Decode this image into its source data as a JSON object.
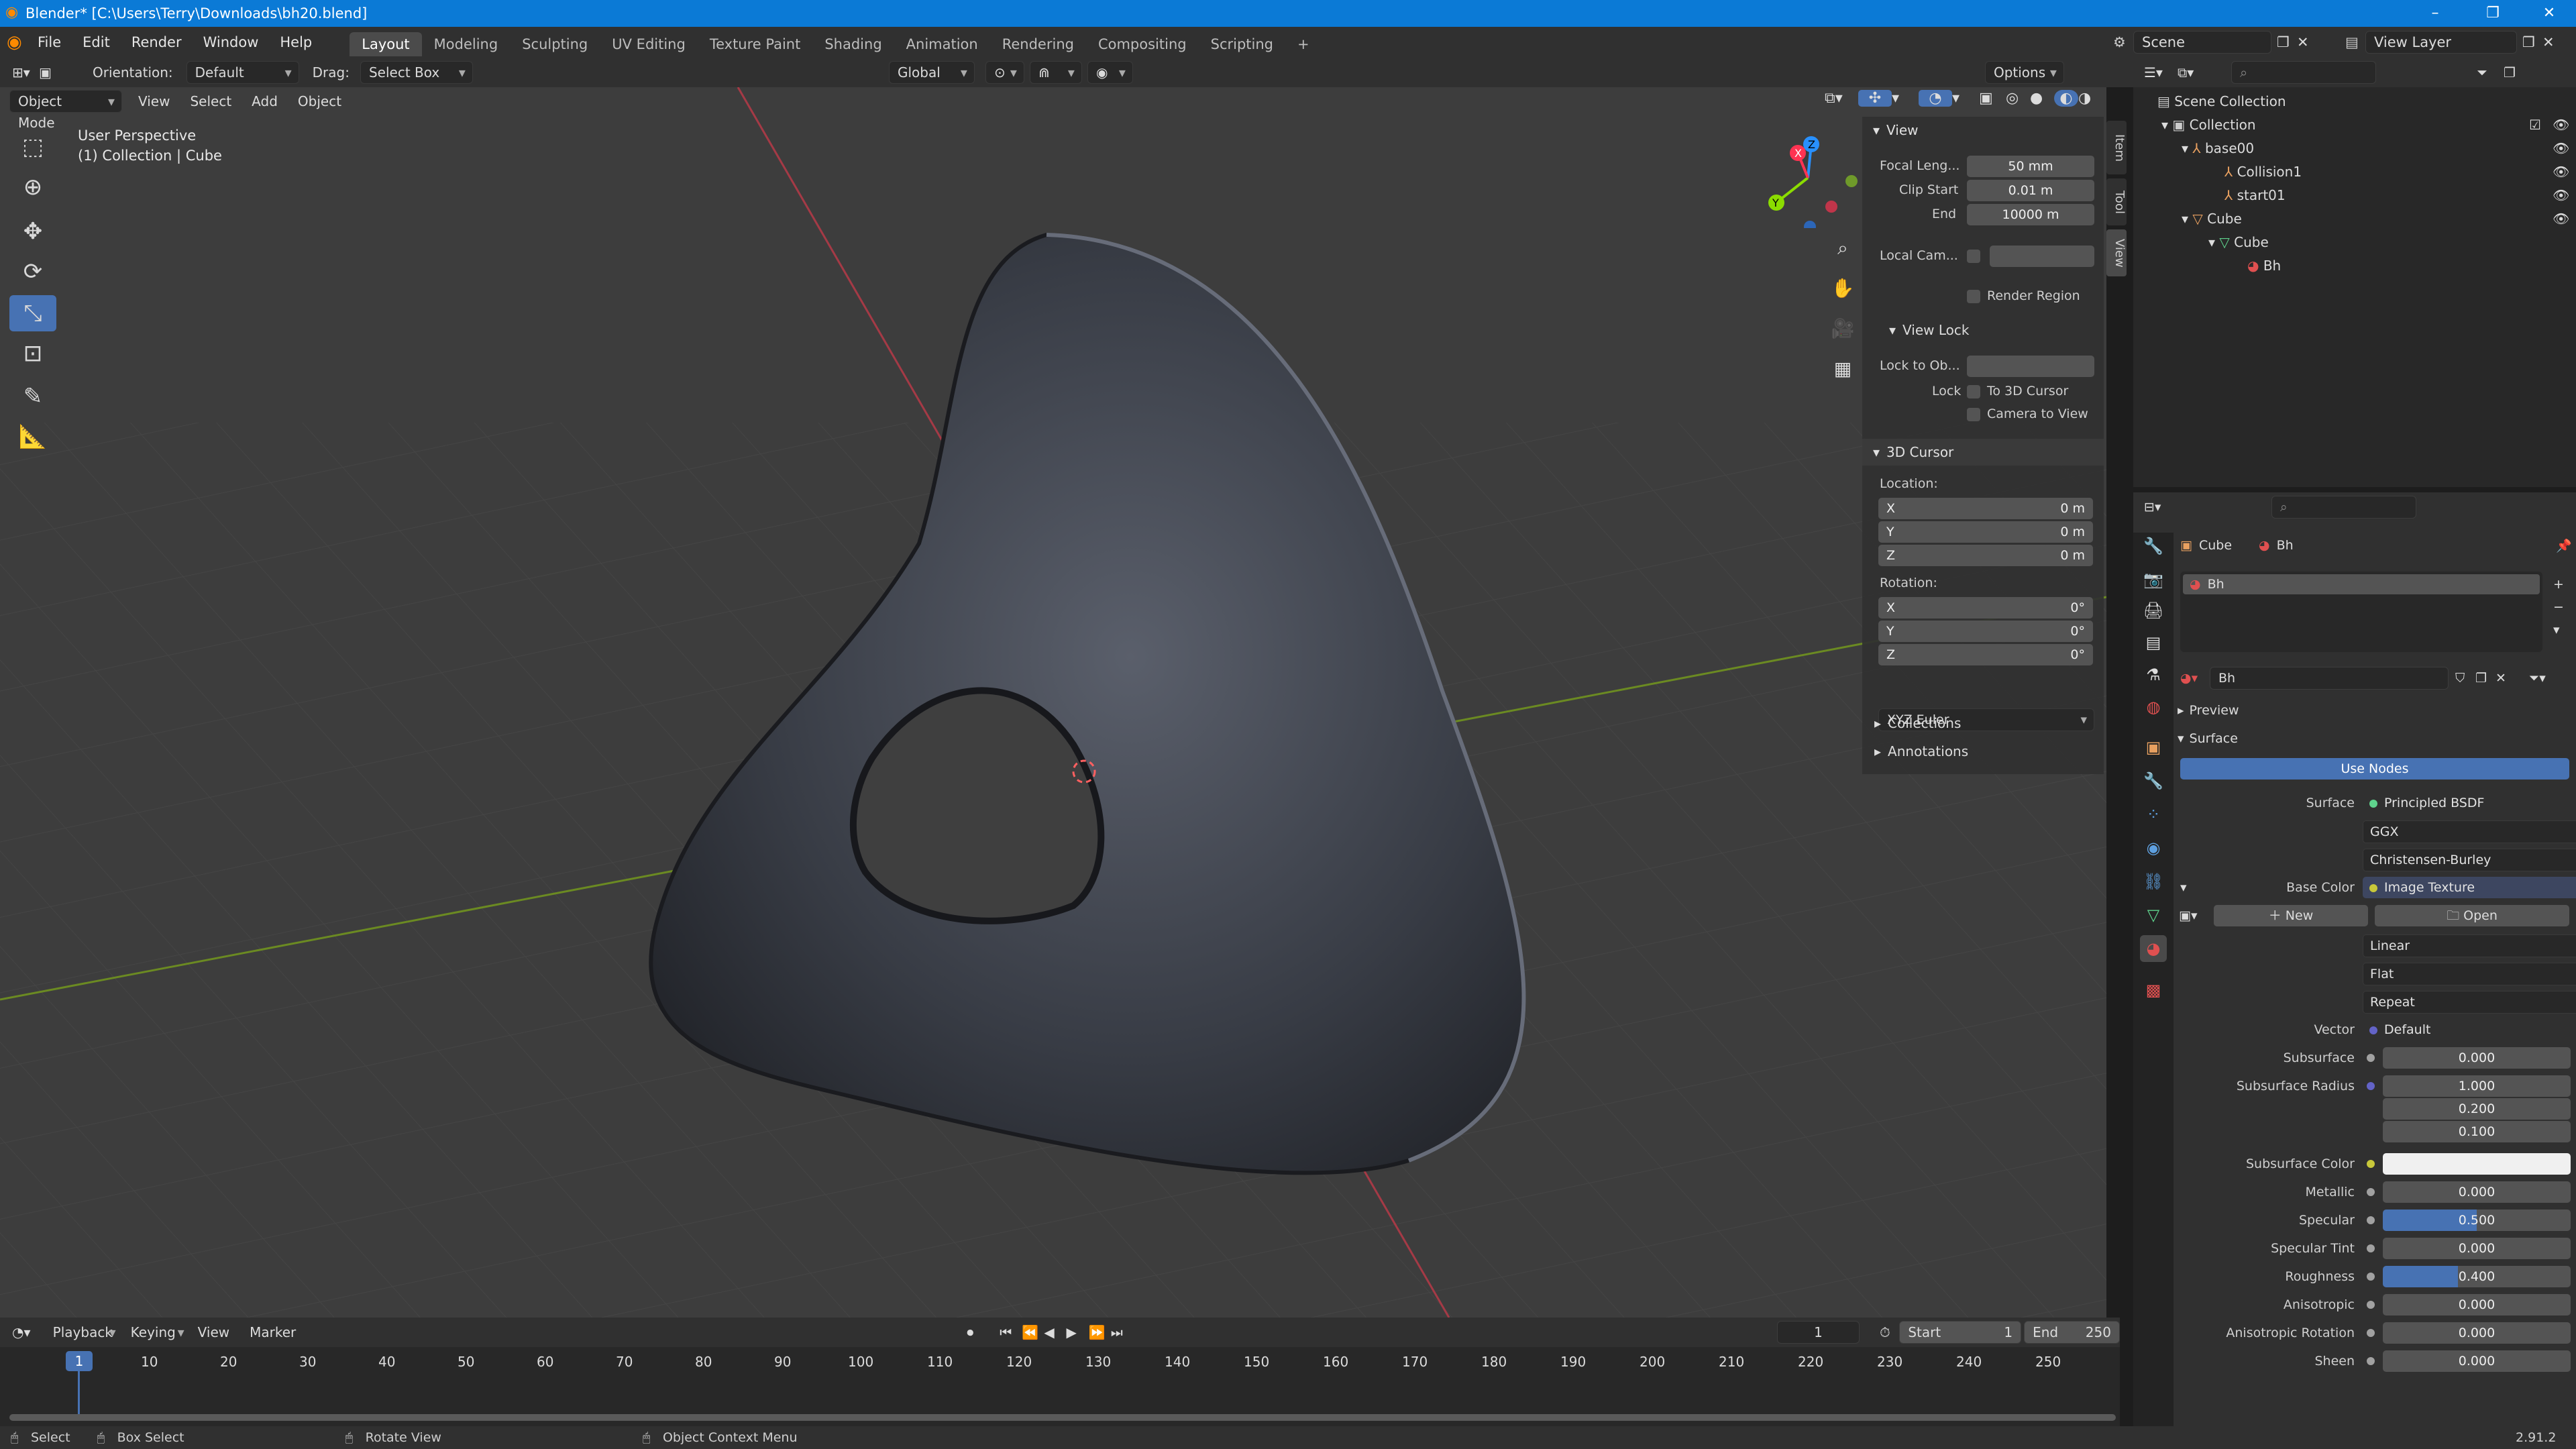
{
  "window": {
    "title": "Blender* [C:\\Users\\Terry\\Downloads\\bh20.blend]"
  },
  "menubar": {
    "menus": [
      "File",
      "Edit",
      "Render",
      "Window",
      "Help"
    ],
    "workspaces": [
      "Layout",
      "Modeling",
      "Sculpting",
      "UV Editing",
      "Texture Paint",
      "Shading",
      "Animation",
      "Rendering",
      "Compositing",
      "Scripting"
    ],
    "add_tab": "+",
    "scene": "Scene",
    "view_layer": "View Layer"
  },
  "header": {
    "orientation_label": "Orientation:",
    "orientation_value": "Default",
    "drag_label": "Drag:",
    "drag_value": "Select Box",
    "transform": "Global",
    "options": "Options"
  },
  "viewport_header": {
    "mode": "Object Mode",
    "menus": [
      "View",
      "Select",
      "Add",
      "Object"
    ]
  },
  "viewport": {
    "perspective": "User Perspective",
    "collection": "(1) Collection | Cube",
    "gizmo": {
      "x": "X",
      "y": "Y",
      "z": "Z"
    }
  },
  "npanel": {
    "tabs": [
      "Item",
      "Tool",
      "View"
    ],
    "view": {
      "title": "View",
      "focal_label": "Focal Leng...",
      "focal": "50 mm",
      "clip_start_label": "Clip Start",
      "clip_start": "0.01 m",
      "end_label": "End",
      "end": "10000 m",
      "local_cam_label": "Local Cam...",
      "render_region": "Render Region"
    },
    "view_lock": {
      "title": "View Lock",
      "lock_to_obj_label": "Lock to Ob...",
      "lock_label": "Lock",
      "to_3d_cursor": "To 3D Cursor",
      "camera_to_view": "Camera to View"
    },
    "cursor": {
      "title": "3D Cursor",
      "location_label": "Location:",
      "loc": [
        {
          "axis": "X",
          "value": "0 m"
        },
        {
          "axis": "Y",
          "value": "0 m"
        },
        {
          "axis": "Z",
          "value": "0 m"
        }
      ],
      "rotation_label": "Rotation:",
      "rot": [
        {
          "axis": "X",
          "value": "0°"
        },
        {
          "axis": "Y",
          "value": "0°"
        },
        {
          "axis": "Z",
          "value": "0°"
        }
      ],
      "mode": "XYZ Euler"
    },
    "collections": "Collections",
    "annotations": "Annotations"
  },
  "outliner": {
    "rows": [
      {
        "label": "Scene Collection",
        "indent": 0
      },
      {
        "label": "Collection",
        "indent": 1
      },
      {
        "label": "base00",
        "indent": 2
      },
      {
        "label": "Collision1",
        "indent": 3
      },
      {
        "label": "start01",
        "indent": 3
      },
      {
        "label": "Cube",
        "indent": 2
      },
      {
        "label": "Cube",
        "indent": 3
      },
      {
        "label": "Bh",
        "indent": 4
      }
    ]
  },
  "properties": {
    "breadcrumb_object": "Cube",
    "breadcrumb_material": "Bh",
    "slot": "Bh",
    "material_name": "Bh",
    "preview": "Preview",
    "surface_section": "Surface",
    "use_nodes": "Use Nodes",
    "surface_label": "Surface",
    "surface_value": "Principled BSDF",
    "distribution": "GGX",
    "subsurface_method": "Christensen-Burley",
    "base_color_label": "Base Color",
    "base_color_value": "Image Texture",
    "new": "New",
    "open": "Open",
    "interp": "Linear",
    "projection": "Flat",
    "extension": "Repeat",
    "vector_label": "Vector",
    "vector_value": "Default",
    "subsurface_label": "Subsurface",
    "subsurface": "0.000",
    "subsurface_radius_label": "Subsurface Radius",
    "subsurface_radius": [
      "1.000",
      "0.200",
      "0.100"
    ],
    "subsurface_color_label": "Subsurface Color",
    "metallic_label": "Metallic",
    "metallic": "0.000",
    "specular_label": "Specular",
    "specular": "0.500",
    "specular_fill": 0.5,
    "specular_tint_label": "Specular Tint",
    "specular_tint": "0.000",
    "roughness_label": "Roughness",
    "roughness": "0.400",
    "roughness_fill": 0.4,
    "anisotropic_label": "Anisotropic",
    "anisotropic": "0.000",
    "anisotropic_rotation_label": "Anisotropic Rotation",
    "anisotropic_rotation": "0.000",
    "sheen_label": "Sheen",
    "sheen": "0.000"
  },
  "timeline": {
    "menus": [
      "Playback",
      "Keying",
      "View",
      "Marker"
    ],
    "current_frame": "1",
    "start_label": "Start",
    "start": "1",
    "end_label": "End",
    "end": "250",
    "ticks": [
      "1",
      "10",
      "20",
      "30",
      "40",
      "50",
      "60",
      "70",
      "80",
      "90",
      "100",
      "110",
      "120",
      "130",
      "140",
      "150",
      "160",
      "170",
      "180",
      "190",
      "200",
      "210",
      "220",
      "230",
      "240",
      "250"
    ]
  },
  "statusbar": {
    "select": "Select",
    "box_select": "Box Select",
    "rotate_view": "Rotate View",
    "context_menu": "Object Context Menu",
    "version": "2.91.2"
  },
  "colors": {
    "accent": "#4772b3",
    "titlebar": "#0b7ad6",
    "x_axis": "#ff3352",
    "y_axis": "#8bdc00",
    "z_axis": "#2890ff"
  }
}
